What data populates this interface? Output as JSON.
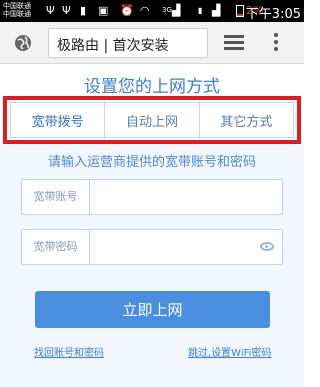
{
  "status_bar": {
    "carrier_1": "中国联通",
    "carrier_2": "中国联通",
    "network_type": "3G",
    "battery_percent": "2%",
    "time": "下午3:05"
  },
  "toolbar": {
    "url_text": "极路由 | 首次安装"
  },
  "page": {
    "title": "设置您的上网方式",
    "tabs": [
      {
        "label": "宽带拨号",
        "active": true
      },
      {
        "label": "自动上网",
        "active": false
      },
      {
        "label": "其它方式",
        "active": false
      }
    ],
    "prompt": "请输入运营商提供的宽带账号和密码",
    "account_label": "宽带账号",
    "account_value": "",
    "password_label": "宽带密码",
    "password_value": "",
    "submit_label": "立即上网",
    "link_recover": "找回账号和密码",
    "link_skip": "跳过,设置WiFi密码"
  },
  "colors": {
    "accent": "#4a8ee0",
    "highlight": "#d32027",
    "title": "#3d7fc9"
  }
}
